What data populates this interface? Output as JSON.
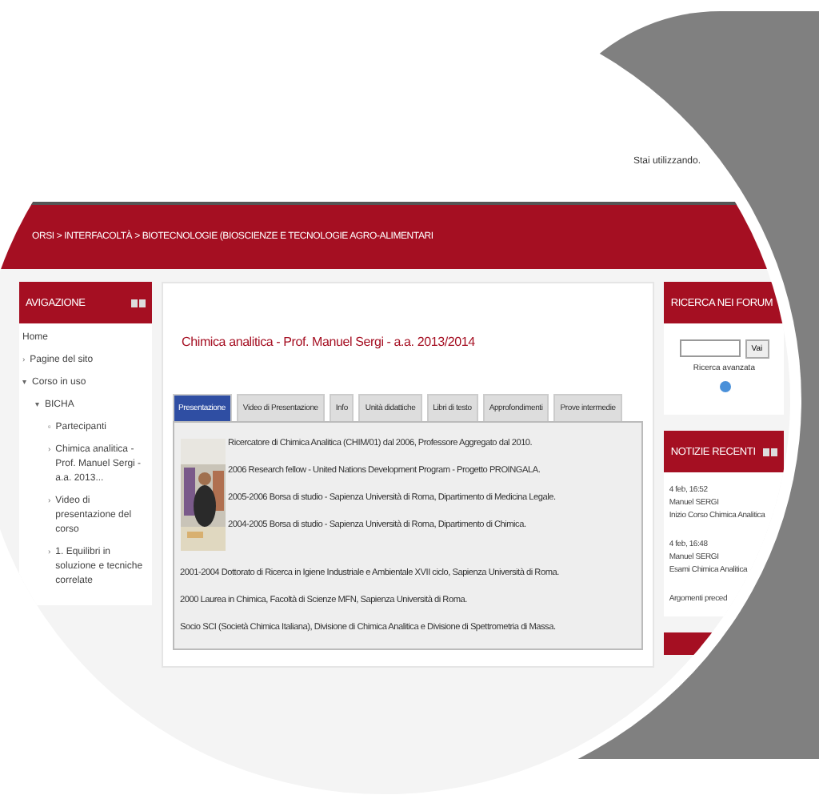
{
  "header": {
    "user_notice": "Stai utilizzando."
  },
  "breadcrumb": "ORSI > INTERFACOLTÀ > BIOTECNOLOGIE (BIOSCIENZE E TECNOLOGIE AGRO-ALIMENTARI",
  "navigation": {
    "title": "AVIGAZIONE",
    "items": [
      {
        "label": "Home"
      },
      {
        "label": "Pagine del sito",
        "marker": "›"
      },
      {
        "label": "Corso in uso",
        "marker": "▾",
        "children": [
          {
            "label": "BICHA",
            "marker": "▾",
            "children": [
              {
                "label": "Partecipanti",
                "marker": "▫"
              },
              {
                "label": "Chimica analitica - Prof. Manuel Sergi - a.a. 2013...",
                "marker": "›"
              },
              {
                "label": "Video di presentazione del corso",
                "marker": "›"
              },
              {
                "label": "1. Equilibri in soluzione e tecniche correlate",
                "marker": "›"
              }
            ]
          }
        ]
      }
    ]
  },
  "course": {
    "title": "Chimica analitica - Prof. Manuel Sergi - a.a. 2013/2014",
    "tabs": [
      {
        "label": "Presentazione",
        "selected": true
      },
      {
        "label": "Video di Presentazione",
        "selected": false
      },
      {
        "label": "Info",
        "selected": false
      },
      {
        "label": "Unità didattiche",
        "selected": false
      },
      {
        "label": "Libri di testo",
        "selected": false
      },
      {
        "label": "Approfondimenti",
        "selected": false
      },
      {
        "label": "Prove intermedie",
        "selected": false
      }
    ],
    "lines": [
      "Ricercatore di Chimica Analitica (CHIM/01) dal 2006, Professore Aggregato dal 2010.",
      "2006 Research fellow - United Nations Development Program - Progetto PROINGALA.",
      "2005-2006 Borsa di studio - Sapienza Università di Roma, Dipartimento di Medicina Legale.",
      "2004-2005 Borsa di studio - Sapienza Università di Roma, Dipartimento di Chimica.",
      "2001-2004 Dottorato di Ricerca in Igiene Industriale e Ambientale XVII ciclo, Sapienza Università di Roma.",
      "2000 Laurea in Chimica, Facoltà di Scienze MFN, Sapienza Università di Roma.",
      "Socio SCI (Società Chimica Italiana), Divisione di Chimica Analitica e Divisione di Spettrometria di Massa."
    ]
  },
  "forum_search": {
    "title": "RICERCA NEI FORUM",
    "button": "Vai",
    "advanced_link": "Ricerca avanzata"
  },
  "news": {
    "title": "NOTIZIE RECENTI",
    "items": [
      {
        "date": "4 feb, 16:52",
        "author": "Manuel SERGI",
        "subject": "Inizio Corso Chimica Analitica"
      },
      {
        "date": "4 feb, 16:48",
        "author": "Manuel SERGI",
        "subject": "Esami Chimica Analitica"
      }
    ],
    "more_link": "Argomenti preced"
  }
}
